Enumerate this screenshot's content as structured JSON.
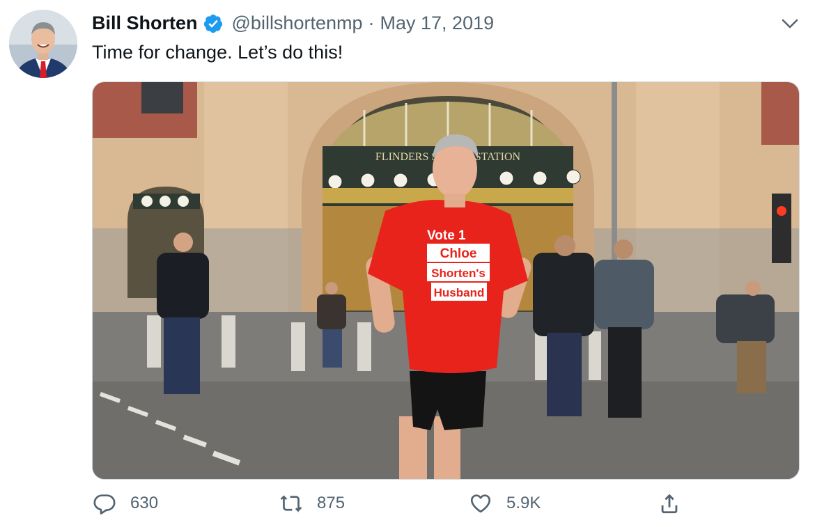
{
  "user": {
    "display_name": "Bill Shorten",
    "handle": "@billshortenmp",
    "separator": "·",
    "date": "May 17, 2019",
    "verified": true
  },
  "tweet": {
    "text": "Time for change. Let’s do this!"
  },
  "photo": {
    "station_sign": "FLINDERS STREET STATION",
    "shirt_lines": [
      "Vote 1",
      "Chloe",
      "Shorten's",
      "Husband"
    ]
  },
  "actions": {
    "reply_count": "630",
    "retweet_count": "875",
    "like_count": "5.9K"
  },
  "colors": {
    "verified_blue": "#1d9bf0",
    "muted_text": "#536471",
    "shirt_red": "#e8231c"
  },
  "icons": [
    "verified-badge-icon",
    "chevron-down-icon",
    "reply-icon",
    "retweet-icon",
    "like-icon",
    "share-icon"
  ]
}
